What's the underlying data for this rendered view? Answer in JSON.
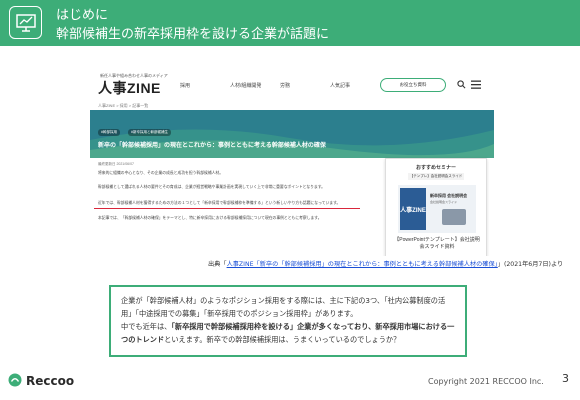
{
  "slide": {
    "kicker": "はじめに",
    "title": "幹部候補生の新卒採用枠を設ける企業が話題に"
  },
  "screenshot": {
    "site_tagline": "新任人事や組み合わせ人事のメディア",
    "site_logo": "人事ZINE",
    "nav": [
      "採用",
      "人材/組織開発",
      "労務",
      "人気記事"
    ],
    "nav_button": "お役立ち資料",
    "breadcrumb": "人事ZINE > 採用 > 記事一覧",
    "tags": [
      "#幹部採用",
      "#新卒採用と幹部候補生"
    ],
    "article_title": "新卒の「幹部候補採用」の現在とこれから：事例とともに考える幹部候補人材の確保",
    "date": "最終更新日 2021/06/07",
    "lines": [
      "将来的に組織の中心となり、その企業の成長と成功を担う幹部候補人材。",
      "幹部候補として選ばれる人材の要件とその育成は、企業が経営戦略や事業計画を実現していく上で非常に重要なポイントとなります。",
      "近年では、幹部候補人材を獲得するための方法の１つとして「新卒採用で幹部候補枠を準備する」という新しいやり方も話題になっています。",
      "本記事では、「幹部候補人材の確保」をテーマとし、特に新卒採用における幹部候補採用について現在の事例とともに考察します。"
    ],
    "card": {
      "title": "おすすめセミナー",
      "sub": "【テンプレ】会社説明会スライド",
      "book_cover": "人事ZINE",
      "book_title": "新卒採用 会社説明会",
      "book_sub": "会社説明会スライド",
      "text": "【PowerPointテンプレート】会社説明会スライド資料"
    }
  },
  "source": {
    "prefix": "出典「",
    "link": "人事ZINE「新卒の「幹部候補採用」の現在とこれから：事例とともに考える幹部候補人材の確保」",
    "suffix": "」(2021年6月7日)より"
  },
  "quote": {
    "p1": "企業が「幹部候補人材」のようなポジション採用をする際には、主に下記の3つ、「社内公募制度の活用」「中途採用での募集」「新卒採用でのポジション採用枠」があります。",
    "p2a": "中でも近年は、",
    "p2b": "「新卒採用で幹部候補採用枠を設ける」企業が多くなっており、新卒採用市場における一つのトレンド",
    "p2c": "といえます。新卒での幹部候補採用は、うまくいっているのでしょうか？"
  },
  "footer": {
    "brand": "Reccoo",
    "copyright": "Copyright 2021 RECCOO Inc.",
    "page": "3"
  },
  "colors": {
    "accent": "#3dad78",
    "link": "#1a4fd6",
    "underline": "#d9263b"
  }
}
